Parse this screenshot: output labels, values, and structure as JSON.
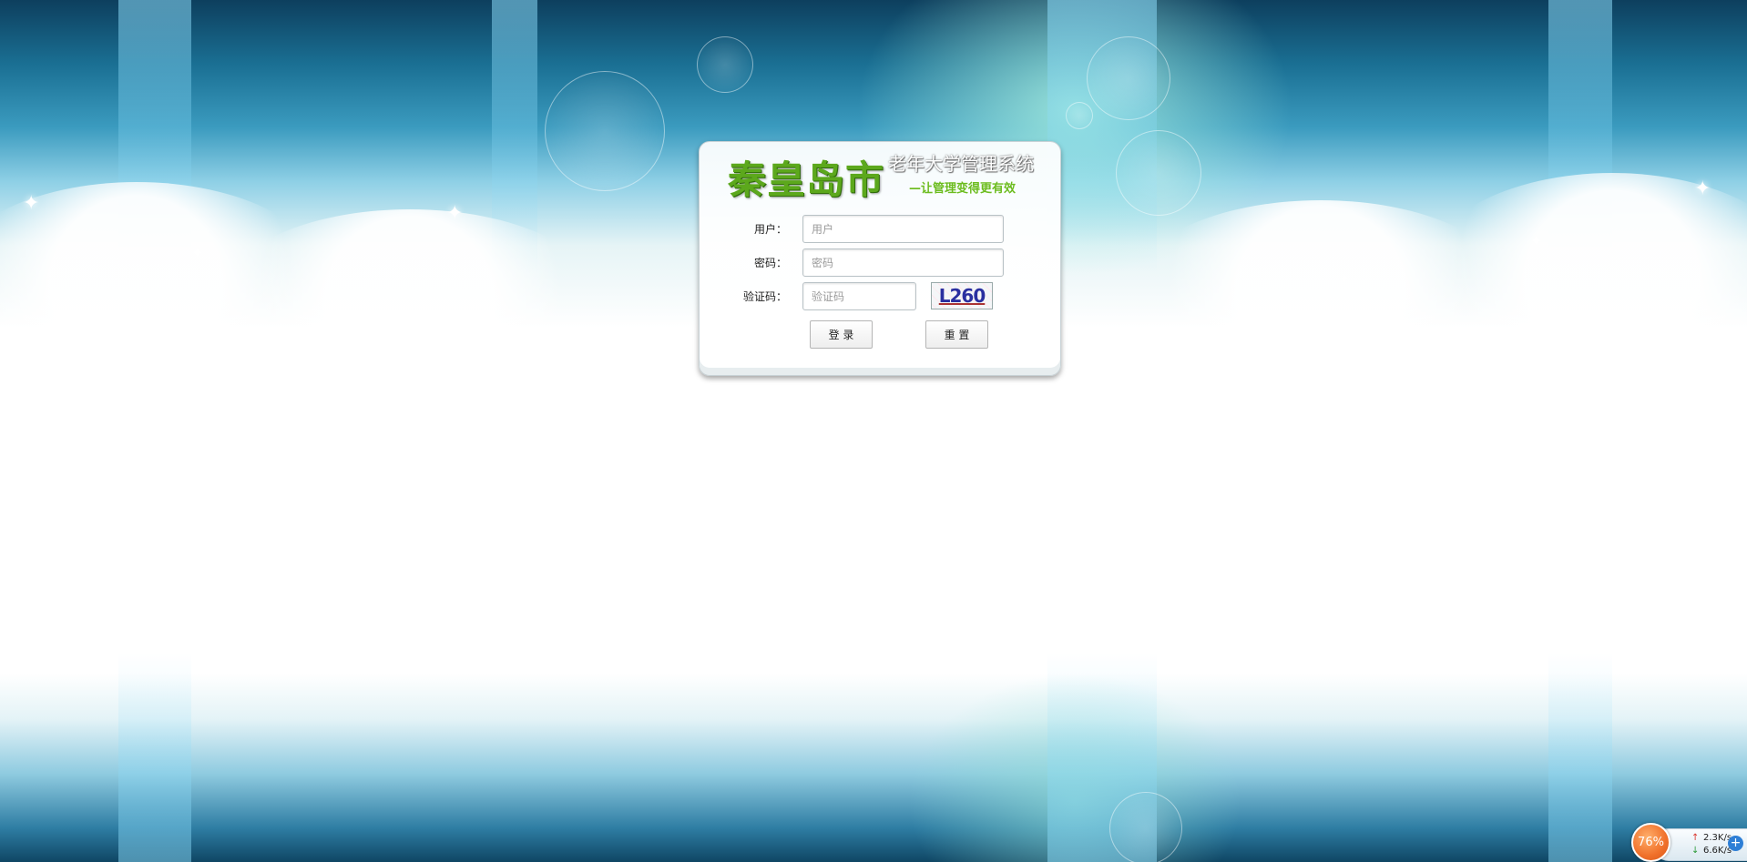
{
  "login": {
    "brand": "秦皇岛市",
    "system_title": "老年大学管理系统",
    "slogan": "—让管理变得更有效",
    "username": {
      "label": "用户：",
      "placeholder": "用户",
      "value": ""
    },
    "password": {
      "label": "密码：",
      "placeholder": "密码",
      "value": ""
    },
    "captcha": {
      "label": "验证码：",
      "placeholder": "验证码",
      "value": "",
      "image_text": "L260"
    },
    "login_button": "登 录",
    "reset_button": "重 置"
  },
  "network_widget": {
    "percent": "76%",
    "upload_speed": "2.3K/s",
    "download_speed": "6.6K/s",
    "colors": {
      "gauge": "#f0702a",
      "upload_arrow": "#d9342b",
      "download_arrow": "#2e9a3a"
    }
  },
  "colors": {
    "brand_green": "#5ca81c",
    "slogan_green": "#6cbc1e",
    "sky_dark": "#0d3f5e",
    "sky_light": "#8fd0e6"
  }
}
